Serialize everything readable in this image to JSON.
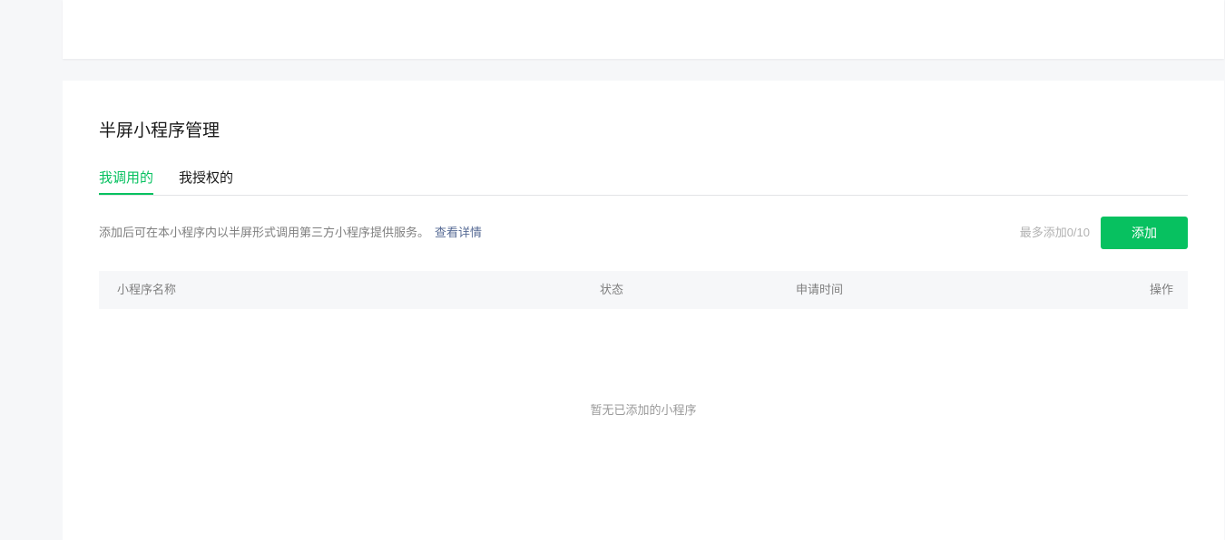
{
  "section": {
    "title": "半屏小程序管理"
  },
  "tabs": [
    {
      "label": "我调用的",
      "active": true
    },
    {
      "label": "我授权的",
      "active": false
    }
  ],
  "description": {
    "text": "添加后可在本小程序内以半屏形式调用第三方小程序提供服务。",
    "link": "查看详情"
  },
  "quota": {
    "text": "最多添加0/10"
  },
  "add_button": {
    "label": "添加"
  },
  "table": {
    "columns": [
      "小程序名称",
      "状态",
      "申请时间",
      "操作"
    ],
    "rows": [],
    "empty_text": "暂无已添加的小程序"
  },
  "colors": {
    "accent": "#07c160",
    "link": "#576b95",
    "page_bg": "#f6f7f9"
  }
}
